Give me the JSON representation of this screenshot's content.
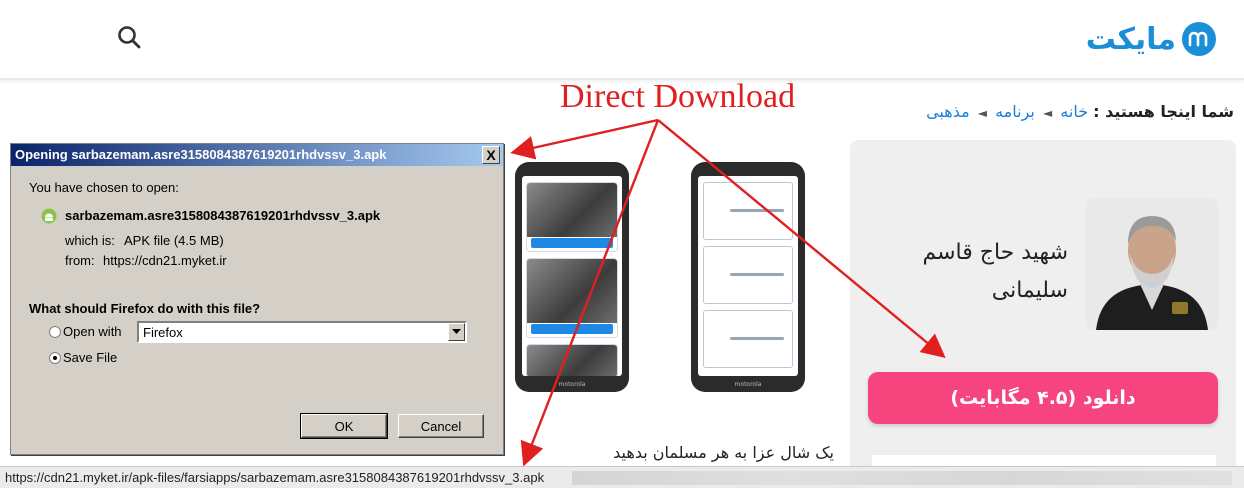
{
  "header": {
    "logo_text": "مایکت",
    "logo_color": "#1a8fd8",
    "search_icon": "search-icon"
  },
  "breadcrumb": {
    "lead": "شما اینجا هستید :",
    "items": [
      "خانه",
      "برنامه",
      "مذهبی"
    ],
    "separator": "◄"
  },
  "app": {
    "title": "شهید حاج قاسم سلیمانی",
    "download_label": "دانلود (۴.۵ مگابایت)",
    "download_color": "#f5447e"
  },
  "screenshots": {
    "phone_brand": "motorola",
    "caption": "یک شال عزا به هر مسلمان بدهید"
  },
  "dialog": {
    "title": "Opening sarbazemam.asre3158084387619201rhdvssv_3.apk",
    "close_label": "X",
    "intro": "You have chosen to open:",
    "filename": "sarbazemam.asre3158084387619201rhdvssv_3.apk",
    "which_is_label": "which is:",
    "which_is_value": "APK file (4.5 MB)",
    "from_label": "from:",
    "from_value": "https://cdn21.myket.ir",
    "question": "What should Firefox do with this file?",
    "open_with_label": "Open with",
    "open_with_app": "Firefox",
    "save_file_label": "Save File",
    "selected_option": "save_file",
    "ok_label": "OK",
    "cancel_label": "Cancel"
  },
  "status_bar": {
    "url": "https://cdn21.myket.ir/apk-files/farsiapps/sarbazemam.asre3158084387619201rhdvssv_3.apk"
  },
  "annotation": {
    "label": "Direct Download",
    "color": "#e02020"
  }
}
